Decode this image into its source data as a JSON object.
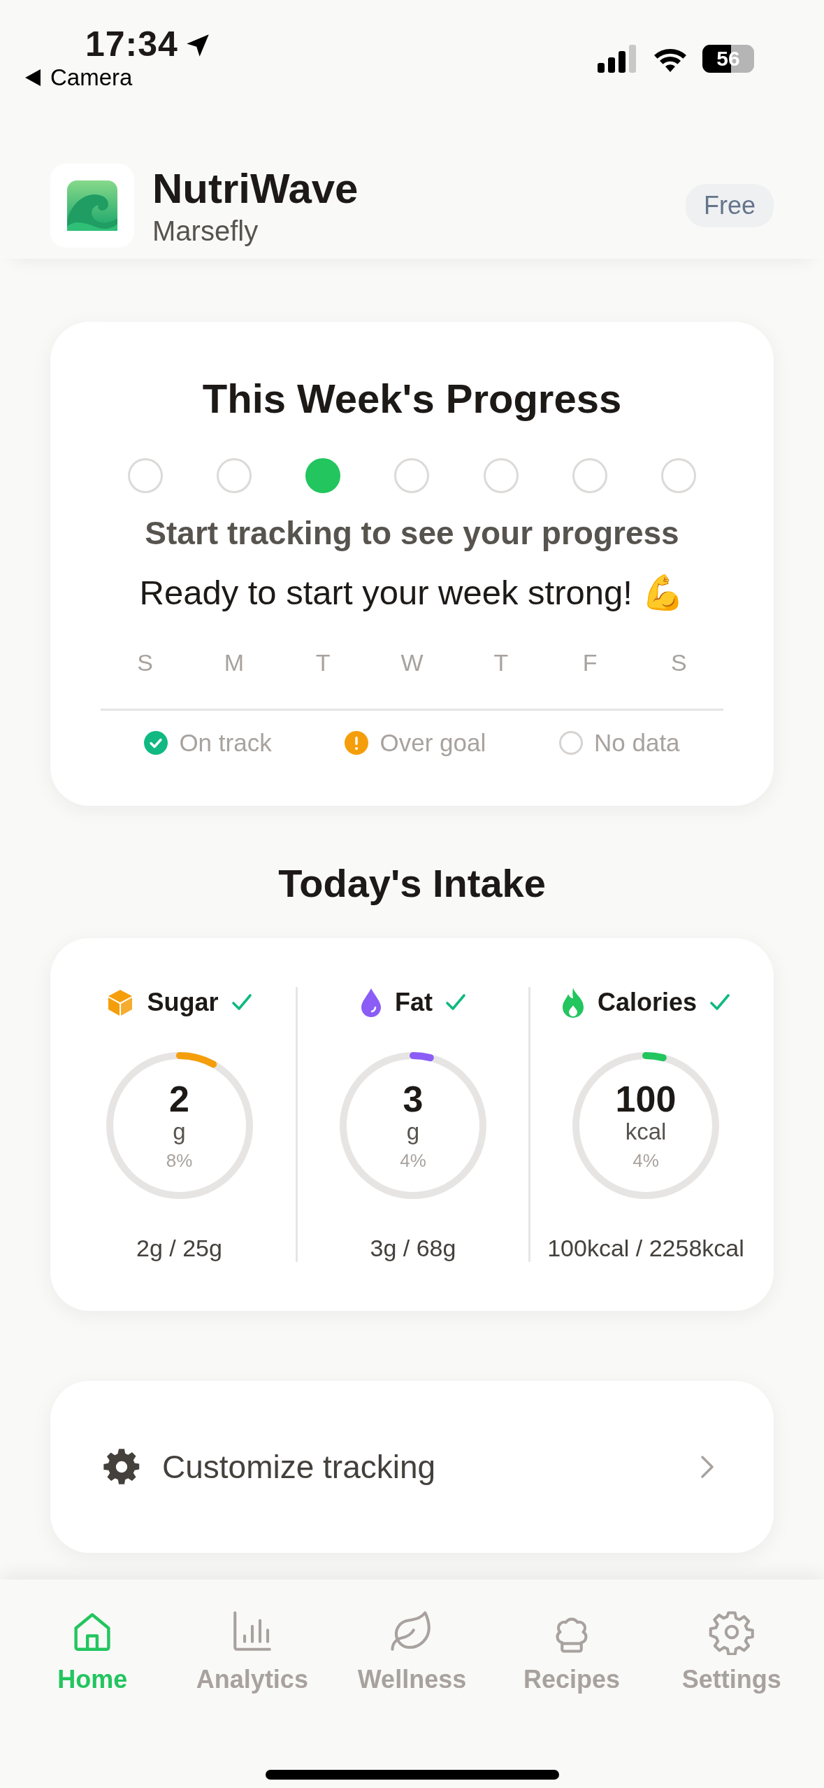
{
  "status_bar": {
    "time": "17:34",
    "back_label": "Camera",
    "battery": "56"
  },
  "header": {
    "app_name": "NutriWave",
    "subtitle": "Marsefly",
    "plan_badge": "Free"
  },
  "week_progress": {
    "title": "This Week's Progress",
    "days": [
      {
        "letter": "S",
        "completed": false
      },
      {
        "letter": "M",
        "completed": false
      },
      {
        "letter": "T",
        "completed": true
      },
      {
        "letter": "W",
        "completed": false
      },
      {
        "letter": "T",
        "completed": false
      },
      {
        "letter": "F",
        "completed": false
      },
      {
        "letter": "S",
        "completed": false
      }
    ],
    "message": "Start tracking to see your progress",
    "motivation": "Ready to start your week strong! 💪",
    "legend": [
      {
        "kind": "on_track",
        "label": "On track"
      },
      {
        "kind": "over_goal",
        "label": "Over goal"
      },
      {
        "kind": "no_data",
        "label": "No data"
      }
    ]
  },
  "intake": {
    "title": "Today's Intake",
    "nutrients": [
      {
        "kind": "sugar",
        "name": "Sugar",
        "on_track": true,
        "value": "2",
        "unit": "g",
        "percent": "8%",
        "level": 0.08,
        "color": "#f59e0b",
        "total": "2g / 25g"
      },
      {
        "kind": "fat",
        "name": "Fat",
        "on_track": true,
        "value": "3",
        "unit": "g",
        "percent": "4%",
        "level": 0.04,
        "color": "#8b5cf6",
        "total": "3g / 68g"
      },
      {
        "kind": "calories",
        "name": "Calories",
        "on_track": true,
        "value": "100",
        "unit": "kcal",
        "percent": "4%",
        "level": 0.04,
        "color": "#22c55e",
        "total": "100kcal / 2258kcal"
      }
    ]
  },
  "customize": {
    "label": "Customize tracking"
  },
  "tab_bar": [
    {
      "kind": "home",
      "label": "Home",
      "selected": true
    },
    {
      "kind": "analytics",
      "label": "Analytics",
      "selected": false
    },
    {
      "kind": "wellness",
      "label": "Wellness",
      "selected": false
    },
    {
      "kind": "recipes",
      "label": "Recipes",
      "selected": false
    },
    {
      "kind": "settings",
      "label": "Settings",
      "selected": false
    }
  ]
}
